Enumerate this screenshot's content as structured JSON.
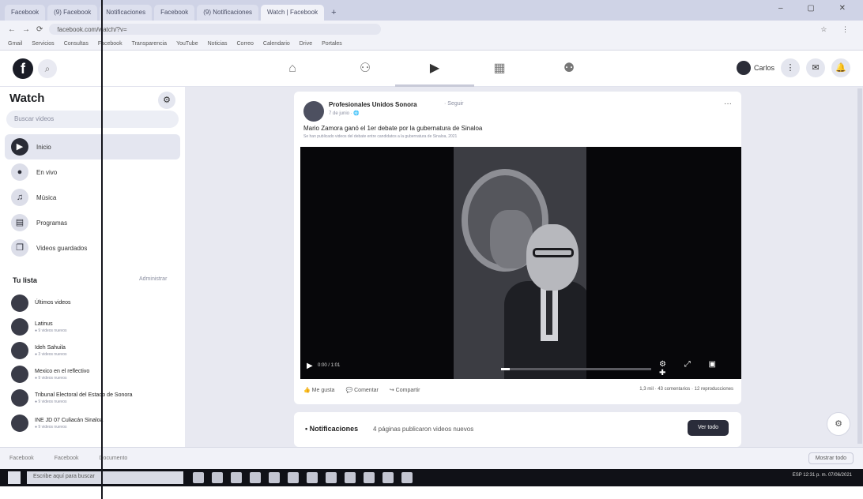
{
  "browser": {
    "tabs": [
      {
        "label": "Facebook"
      },
      {
        "label": "(9) Facebook"
      },
      {
        "label": "Notificaciones"
      },
      {
        "label": "Facebook"
      },
      {
        "label": "(9) Notificaciones"
      },
      {
        "label": "Watch | Facebook"
      }
    ],
    "new_tab": "+",
    "window_controls": "– ▢ ✕",
    "nav_back": "←",
    "nav_forward": "→",
    "nav_reload": "⟳",
    "url": "facebook.com/watch/?v=",
    "addr_icons": "☆ ⋮",
    "bookmarks": [
      "Gmail",
      "Servicios",
      "Consultas",
      "Facebook",
      "Transparencia",
      "YouTube",
      "Noticias",
      "Correo",
      "Calendario",
      "Drive",
      "Portales"
    ]
  },
  "fbnav": {
    "logo": "f",
    "search_icon": "⌕",
    "profile_label": "Carlos",
    "icons": {
      "home": "⌂",
      "friends": "⚇",
      "watch": "▶",
      "marketplace": "▦",
      "groups": "⚉"
    },
    "menu_icon": "⋮",
    "messenger_icon": "✉",
    "bell_icon": "🔔"
  },
  "sidebar": {
    "title": "Watch",
    "gear_icon": "⚙",
    "search_placeholder": "Buscar videos",
    "items": [
      {
        "label": "Inicio",
        "icon": "▶"
      },
      {
        "label": "En vivo",
        "icon": "●"
      },
      {
        "label": "Música",
        "icon": "♫"
      },
      {
        "label": "Programas",
        "icon": "▤"
      },
      {
        "label": "Videos guardados",
        "icon": "❐"
      }
    ],
    "section_title": "Tu lista",
    "section_manage": "Administrar",
    "subscriptions": [
      {
        "name": "Últimos videos",
        "meta": ""
      },
      {
        "name": "Latinus",
        "meta": "● 9 videos nuevos"
      },
      {
        "name": "Ideh Sahuila",
        "meta": "● 3 videos nuevos"
      },
      {
        "name": "Mexico en el reflectivo",
        "meta": "● 9 videos nuevos"
      },
      {
        "name": "Tribunal Electoral del Estado de Sonora",
        "meta": "● 9 videos nuevos"
      },
      {
        "name": "INE JD 07 Culiacán Sinaloa",
        "meta": "● 9 videos nuevos"
      }
    ]
  },
  "post": {
    "author": "Profesionales Unidos Sonora",
    "follow": "· Seguir",
    "date": "7 de junio · 🌐",
    "more_icon": "···",
    "title": "Mario Zamora ganó el 1er debate por la gubernatura de Sinaloa",
    "subtitle": "Se han publicado videos del debate entre candidatos a la gubernatura de Sinaloa, 2021",
    "video": {
      "play_icon": "▶",
      "time": "0:00 / 1:01",
      "progress": 0.06,
      "control_icons": "⚙ ⤢ ▣ ✚"
    },
    "actions": [
      "👍 Me gusta",
      "💬 Comentar",
      "↪ Compartir"
    ],
    "stats": "1,3 mil · 43 comentarios · 12 reproducciones"
  },
  "notifications": {
    "title": "• Notificaciones",
    "description": "4 páginas publicaron videos nuevos",
    "button": "Ver todo"
  },
  "fab_icon": "⚙",
  "downloads": {
    "items": [
      "Facebook",
      "Facebook",
      "Documento"
    ],
    "show_all": "Mostrar todo"
  },
  "taskbar": {
    "search_placeholder": "Escribe aquí para buscar",
    "tray": "ESP  12:31 p. m.  07/06/2021"
  }
}
